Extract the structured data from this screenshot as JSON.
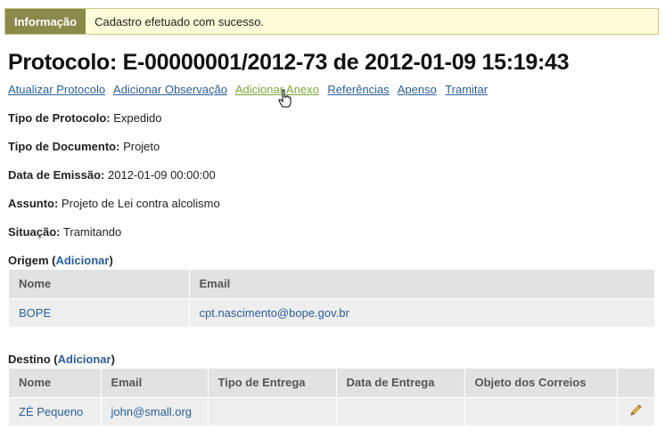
{
  "notice": {
    "label": "Informação",
    "message": "Cadastro efetuado com sucesso."
  },
  "title": "Protocolo: E-00000001/2012-73 de 2012-01-09 15:19:43",
  "actions": [
    {
      "label": "Atualizar Protocolo"
    },
    {
      "label": "Adicionar Observação"
    },
    {
      "label": "Adicionar Anexo"
    },
    {
      "label": "Referências"
    },
    {
      "label": "Apenso"
    },
    {
      "label": "Tramitar"
    }
  ],
  "fields": [
    {
      "label": "Tipo de Protocolo:",
      "value": "Expedido"
    },
    {
      "label": "Tipo de Documento:",
      "value": "Projeto"
    },
    {
      "label": "Data de Emissão:",
      "value": "2012-01-09 00:00:00"
    },
    {
      "label": "Assunto:",
      "value": "Projeto de Lei contra alcolismo"
    },
    {
      "label": "Situação:",
      "value": "Tramitando"
    }
  ],
  "origem": {
    "title": "Origem",
    "add_label": "Adicionar",
    "columns": [
      "Nome",
      "Email"
    ],
    "rows": [
      {
        "nome": "BOPE",
        "email": "cpt.nascimento@bope.gov.br"
      }
    ]
  },
  "destino": {
    "title": "Destino",
    "add_label": "Adicionar",
    "columns": [
      "Nome",
      "Email",
      "Tipo de Entrega",
      "Data de Entrega",
      "Objeto dos Correios"
    ],
    "rows": [
      {
        "nome": "ZÉ Pequeno",
        "email": "john@small.org",
        "tipo": "",
        "data": "",
        "objeto": ""
      }
    ]
  }
}
